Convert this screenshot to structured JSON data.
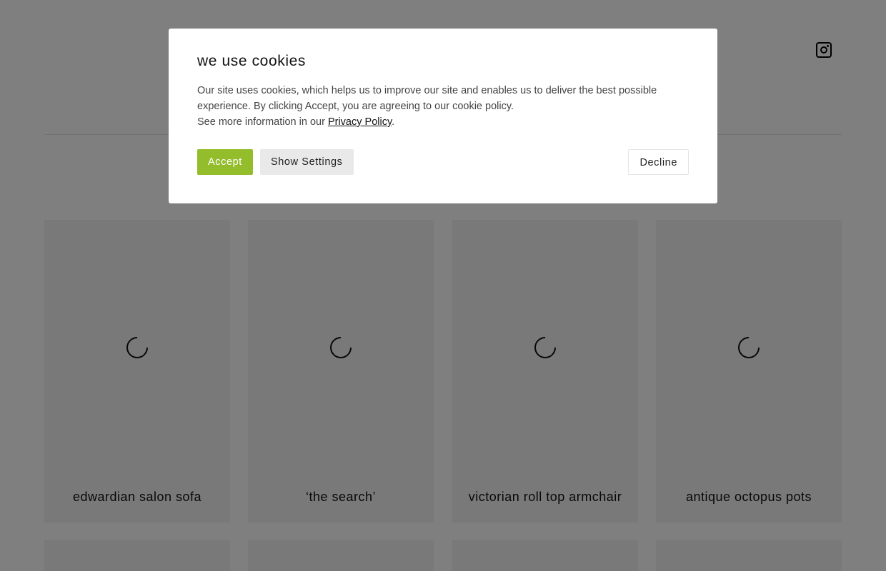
{
  "cookie_banner": {
    "title": "we use cookies",
    "text_line1": "Our site uses cookies, which helps us to improve our site and enables us to deliver the best possible experience. By clicking Accept, you are agreeing to our cookie policy.",
    "text_prefix": "See more information in our ",
    "policy_link": "Privacy Policy",
    "text_suffix": ".",
    "accept_label": "Accept",
    "settings_label": "Show Settings",
    "decline_label": "Decline"
  },
  "products": [
    {
      "title": "edwardian salon sofa"
    },
    {
      "title": "‘the search’"
    },
    {
      "title": "victorian roll top armchair"
    },
    {
      "title": "antique octopus pots"
    }
  ],
  "header": {
    "social_icon": "instagram-icon"
  }
}
